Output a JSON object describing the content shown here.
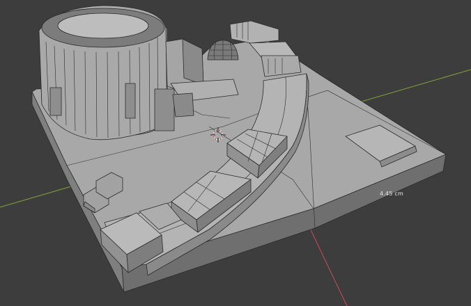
{
  "viewport": {
    "background_color": "#3d3d3d",
    "model_color": "#9e9e9e",
    "x_axis_color": "#c0485a",
    "y_axis_color": "#7a9a3a"
  },
  "measurement": {
    "label": "4.45 cm"
  },
  "cursor": {
    "icon": "3d-cursor-icon"
  }
}
